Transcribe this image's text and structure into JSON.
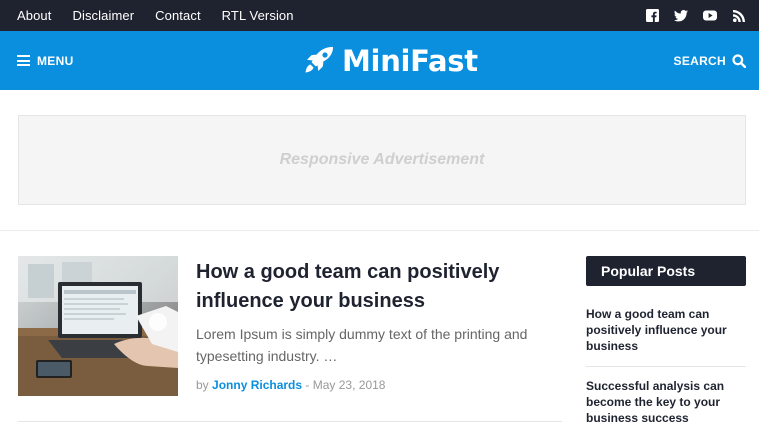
{
  "topbar": {
    "links": [
      "About",
      "Disclaimer",
      "Contact",
      "RTL Version"
    ],
    "social_icons": [
      "facebook-icon",
      "twitter-icon",
      "youtube-icon",
      "rss-icon"
    ]
  },
  "header": {
    "menu_label": "MENU",
    "site_title": "MiniFast",
    "search_label": "SEARCH",
    "color": "#0a8fde"
  },
  "ad": {
    "text": "Responsive Advertisement"
  },
  "post": {
    "title": "How a good team can positively influence your business",
    "excerpt": "Lorem Ipsum is simply dummy text of the printing and typesetting industry. …",
    "by": "by",
    "author": "Jonny Richards",
    "separator": "-",
    "date": "May 23, 2018"
  },
  "sidebar": {
    "widget_title": "Popular Posts",
    "items": [
      "How a good team can positively influence your business",
      "Successful analysis can become the key to your business success"
    ]
  }
}
